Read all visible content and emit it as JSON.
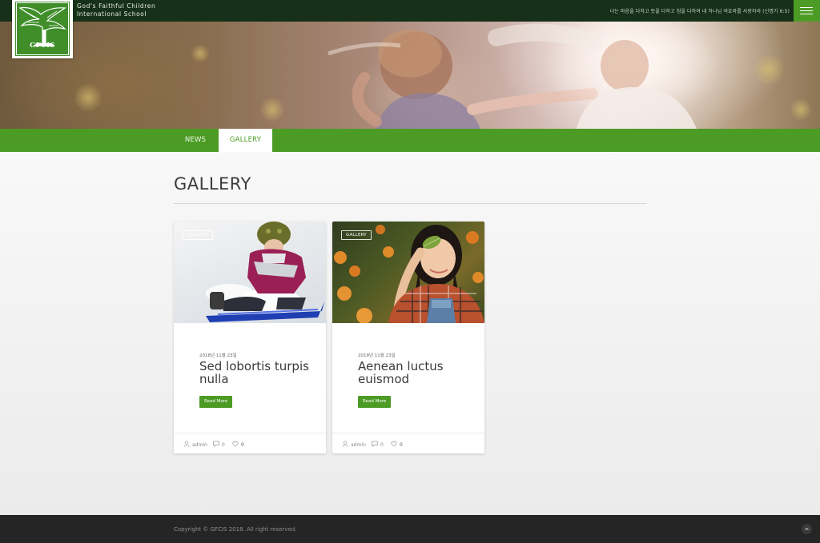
{
  "header": {
    "school_name_line1": "God's Faithful Children",
    "school_name_line2": "International School",
    "logo_text": "GFCIS",
    "verse": "너는 마음을 다하고 뜻을 다하고 힘을 다하여 네 하나님 여호와를 사랑하라 (신명기 6:5)",
    "menu_icon": "hamburger-menu-icon"
  },
  "tabs": [
    {
      "label": "NEWS",
      "active": false
    },
    {
      "label": "GALLERY",
      "active": true
    }
  ],
  "page_title": "GALLERY",
  "posts": [
    {
      "category": "GALLERY",
      "date": "2018년 11월 23일",
      "title": "Sed lobortis turpis nulla",
      "read_more": "Read More",
      "author": "admin",
      "comments": "0",
      "likes": "0"
    },
    {
      "category": "GALLERY",
      "date": "2018년 11월 23일",
      "title": "Aenean luctus euismod",
      "read_more": "Read More",
      "author": "admin",
      "comments": "0",
      "likes": "0"
    }
  ],
  "footer": {
    "copyright": "Copyright © GFCIS 2018. All right reserved.",
    "back_to_top_icon": "chevron-up-icon"
  },
  "colors": {
    "brand_green": "#4c9b24",
    "topbar": "#173019",
    "footer": "#252525"
  }
}
